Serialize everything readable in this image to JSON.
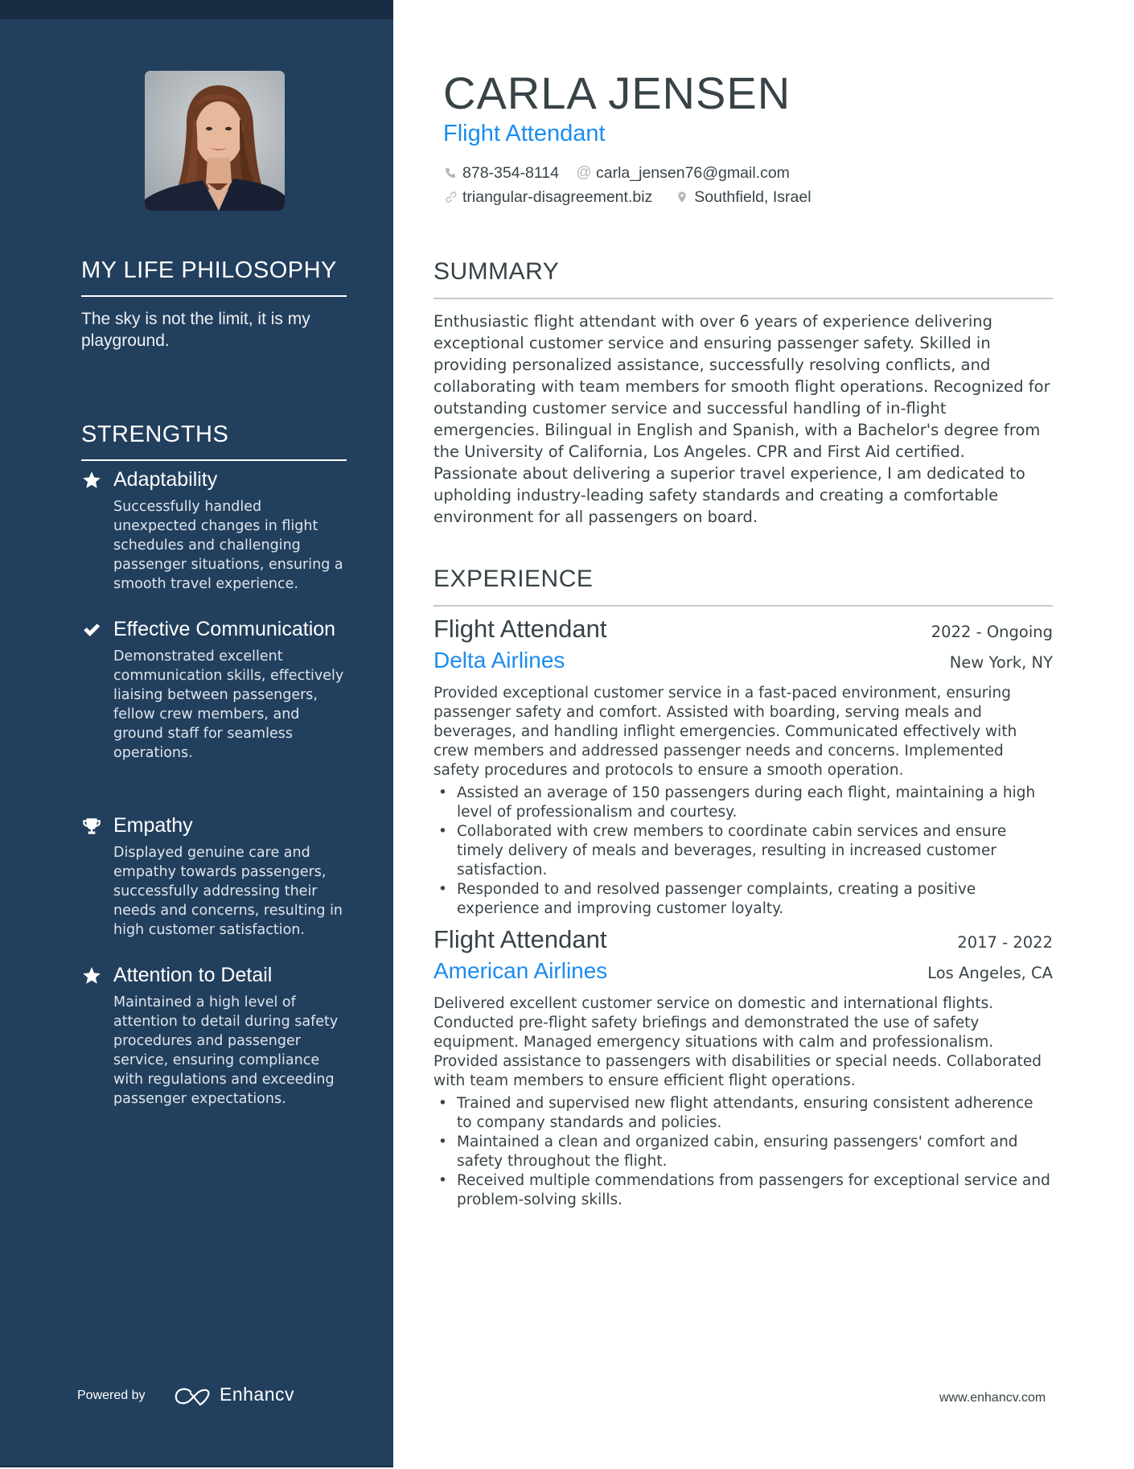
{
  "profile": {
    "name": "CARLA JENSEN",
    "title": "Flight Attendant",
    "photo_alt": "Portrait of Carla Jensen",
    "contacts": {
      "phone": "878-354-8114",
      "email": "carla_jensen76@gmail.com",
      "website": "triangular-disagreement.biz",
      "location": "Southfield, Israel"
    },
    "icons": {
      "phone": "phone-icon",
      "email": "at-icon",
      "website": "link-icon",
      "location": "map-pin-icon"
    }
  },
  "sidebar": {
    "philosophy": {
      "heading": "MY LIFE PHILOSOPHY",
      "text": "The sky is not the limit, it is my playground."
    },
    "strengths": {
      "heading": "STRENGTHS",
      "items": [
        {
          "icon": "star-icon",
          "title": "Adaptability",
          "description": "Successfully handled unexpected changes in flight schedules and challenging passenger situations, ensuring a smooth travel experience."
        },
        {
          "icon": "check-icon",
          "title": "Effective Communication",
          "description": "Demonstrated excellent communication skills, effectively liaising between passengers, fellow crew members, and ground staff for seamless operations."
        },
        {
          "icon": "trophy-icon",
          "title": "Empathy",
          "description": "Displayed genuine care and empathy towards passengers, successfully addressing their needs and concerns, resulting in high customer satisfaction."
        },
        {
          "icon": "star-icon",
          "title": "Attention to Detail",
          "description": "Maintained a high level of attention to detail during safety procedures and passenger service, ensuring compliance with regulations and exceeding passenger expectations."
        }
      ]
    },
    "footer": {
      "powered_by": "Powered by",
      "brand": "Enhancv"
    }
  },
  "summary": {
    "heading": "SUMMARY",
    "text": "Enthusiastic flight attendant with over 6 years of experience delivering exceptional customer service and ensuring passenger safety. Skilled in providing personalized assistance, successfully resolving conflicts, and collaborating with team members for smooth flight operations. Recognized for outstanding customer service and successful handling of in-flight emergencies. Bilingual in English and Spanish, with a Bachelor's degree from the University of California, Los Angeles. CPR and First Aid certified. Passionate about delivering a superior travel experience, I am dedicated to upholding industry-leading safety standards and creating a comfortable environment for all passengers on board."
  },
  "experience": {
    "heading": "EXPERIENCE",
    "jobs": [
      {
        "title": "Flight Attendant",
        "dates": "2022 - Ongoing",
        "company": "Delta Airlines",
        "location": "New York, NY",
        "description": "Provided exceptional customer service in a fast-paced environment, ensuring passenger safety and comfort. Assisted with boarding, serving meals and beverages, and handling inflight emergencies. Communicated effectively with crew members and addressed passenger needs and concerns. Implemented safety procedures and protocols to ensure a smooth operation.",
        "bullets": [
          "Assisted an average of 150 passengers during each flight, maintaining a high level of professionalism and courtesy.",
          "Collaborated with crew members to coordinate cabin services and ensure timely delivery of meals and beverages, resulting in increased customer satisfaction.",
          "Responded to and resolved passenger complaints, creating a positive experience and improving customer loyalty."
        ]
      },
      {
        "title": "Flight Attendant",
        "dates": "2017 - 2022",
        "company": "American Airlines",
        "location": "Los Angeles, CA",
        "description": "Delivered excellent customer service on domestic and international flights. Conducted pre-flight safety briefings and demonstrated the use of safety equipment. Managed emergency situations with calm and professionalism. Provided assistance to passengers with disabilities or special needs. Collaborated with team members to ensure efficient flight operations.",
        "bullets": [
          "Trained and supervised new flight attendants, ensuring consistent adherence to company standards and policies.",
          "Maintained a clean and organized cabin, ensuring passengers' comfort and safety throughout the flight.",
          "Received multiple commendations from passengers for exceptional service and problem-solving skills."
        ]
      }
    ]
  },
  "footer": {
    "website": "www.enhancv.com"
  },
  "colors": {
    "sidebar_bg": "#223f5d",
    "topbar_bg": "#1a2c44",
    "accent": "#1b8cf0",
    "text": "#384347",
    "icon_gray": "#b3b7ba"
  }
}
